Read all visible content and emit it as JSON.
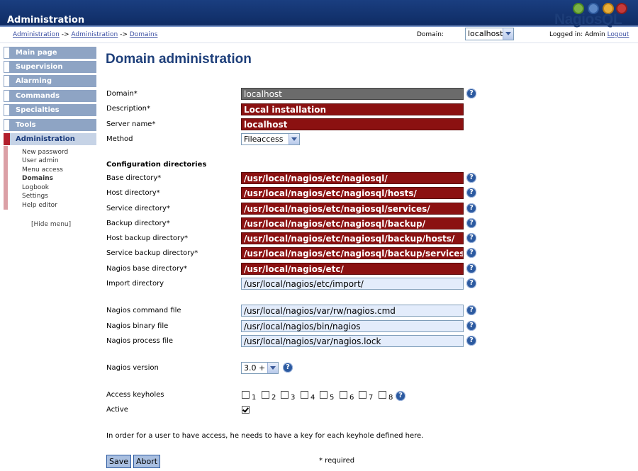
{
  "app": {
    "title": "Administration",
    "logo": "NagiosQL"
  },
  "breadcrumb": {
    "part1": "Administration",
    "sep1": "->",
    "part2": "Administration",
    "sep2": "->",
    "part3": "Domains"
  },
  "domain_selector": {
    "label": "Domain:",
    "value": "localhost"
  },
  "login": {
    "text": "Logged in: Admin",
    "logout": "Logout"
  },
  "menu": {
    "items": [
      "Main page",
      "Supervision",
      "Alarming",
      "Commands",
      "Specialties",
      "Tools",
      "Administration"
    ],
    "submenu": [
      "New password",
      "User admin",
      "Menu access",
      "Domains",
      "Logbook",
      "Settings",
      "Help editor"
    ],
    "hide": "[Hide menu]"
  },
  "page_title": "Domain administration",
  "form": {
    "domain_label": "Domain*",
    "domain_value": "localhost",
    "description_label": "Description*",
    "description_value": "Local installation",
    "server_label": "Server name*",
    "server_value": "localhost",
    "method_label": "Method",
    "method_value": "Fileaccess",
    "config_heading": "Configuration directories",
    "base_label": "Base directory*",
    "base_value": "/usr/local/nagios/etc/nagiosql/",
    "host_label": "Host directory*",
    "host_value": "/usr/local/nagios/etc/nagiosql/hosts/",
    "service_label": "Service directory*",
    "service_value": "/usr/local/nagios/etc/nagiosql/services/",
    "backup_label": "Backup directory*",
    "backup_value": "/usr/local/nagios/etc/nagiosql/backup/",
    "hostbackup_label": "Host backup directory*",
    "hostbackup_value": "/usr/local/nagios/etc/nagiosql/backup/hosts/",
    "servicebackup_label": "Service backup directory*",
    "servicebackup_value": "/usr/local/nagios/etc/nagiosql/backup/services/",
    "nagiosbase_label": "Nagios base directory*",
    "nagiosbase_value": "/usr/local/nagios/etc/",
    "import_label": "Import directory",
    "import_value": "/usr/local/nagios/etc/import/",
    "cmdfile_label": "Nagios command file",
    "cmdfile_value": "/usr/local/nagios/var/rw/nagios.cmd",
    "binary_label": "Nagios binary file",
    "binary_value": "/usr/local/nagios/bin/nagios",
    "process_label": "Nagios process file",
    "process_value": "/usr/local/nagios/var/nagios.lock",
    "version_label": "Nagios version",
    "version_value": "3.0 +",
    "keyholes_label": "Access keyholes",
    "keyholes": [
      "1",
      "2",
      "3",
      "4",
      "5",
      "6",
      "7",
      "8"
    ],
    "active_label": "Active",
    "note": "In order for a user to have access, he needs to have a key for each keyhole defined here.",
    "save": "Save",
    "abort": "Abort",
    "required": "* required",
    "help": "?"
  },
  "colors": {
    "required_field": "#8b1111",
    "header": "#1a3e80",
    "menu": "#8ea4c4"
  }
}
